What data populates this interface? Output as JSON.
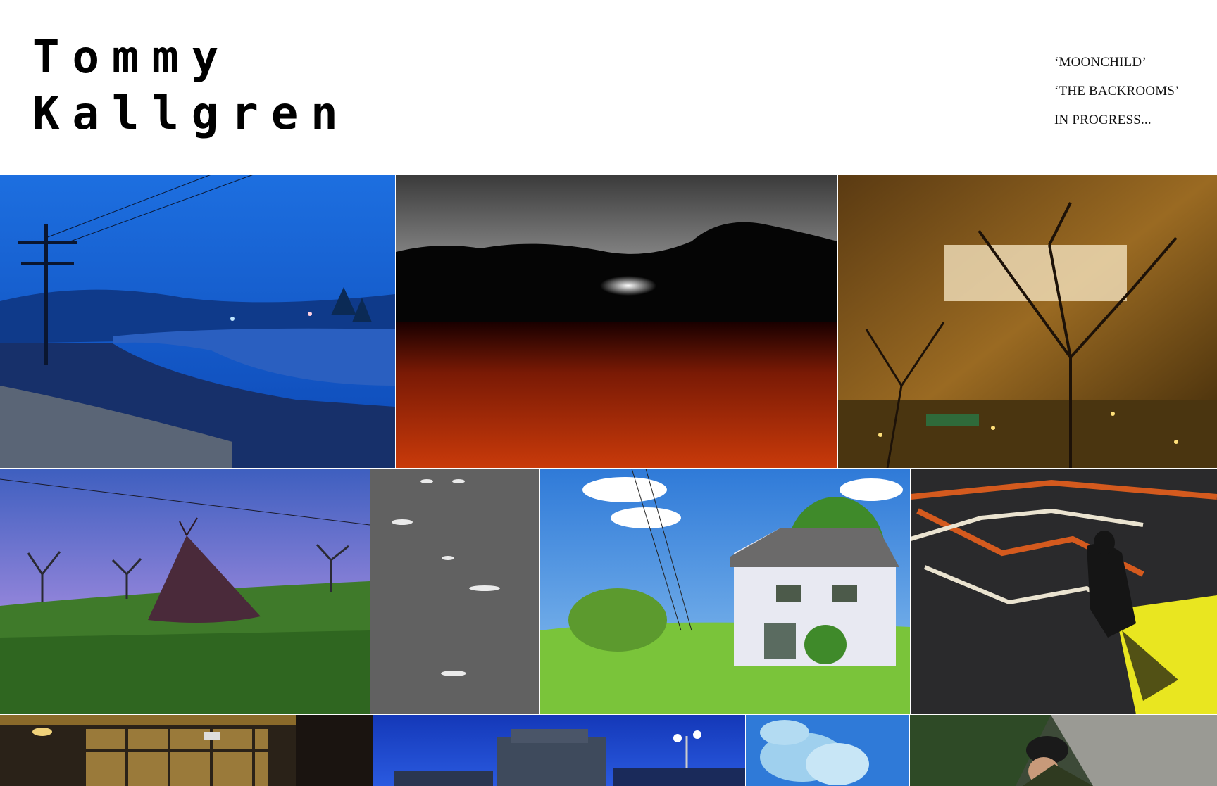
{
  "site": {
    "title_line1": "Tommy",
    "title_line2": "Kallgren"
  },
  "nav": {
    "items": [
      {
        "label": "‘MOONCHILD’"
      },
      {
        "label": "‘THE BACKROOMS’"
      },
      {
        "label": "IN PROGRESS..."
      }
    ]
  },
  "gallery": {
    "photos": [
      {
        "subject": "river-utility-pole-blue-dusk"
      },
      {
        "subject": "dark-field-red-grass-under-stormy-sky"
      },
      {
        "subject": "bare-tree-golden-lights-night"
      },
      {
        "subject": "teepee-on-grassy-hill-purple-sky"
      },
      {
        "subject": "asphalt-with-white-dots"
      },
      {
        "subject": "suburban-house-power-lines-lawn"
      },
      {
        "subject": "construction-barriers-shadow-figure"
      },
      {
        "subject": "storefront-night-interior"
      },
      {
        "subject": "building-with-streetlight-blue-dusk"
      },
      {
        "subject": "pale-blue-abstract-shapes"
      },
      {
        "subject": "person-in-beanie-sidewalk"
      }
    ]
  }
}
